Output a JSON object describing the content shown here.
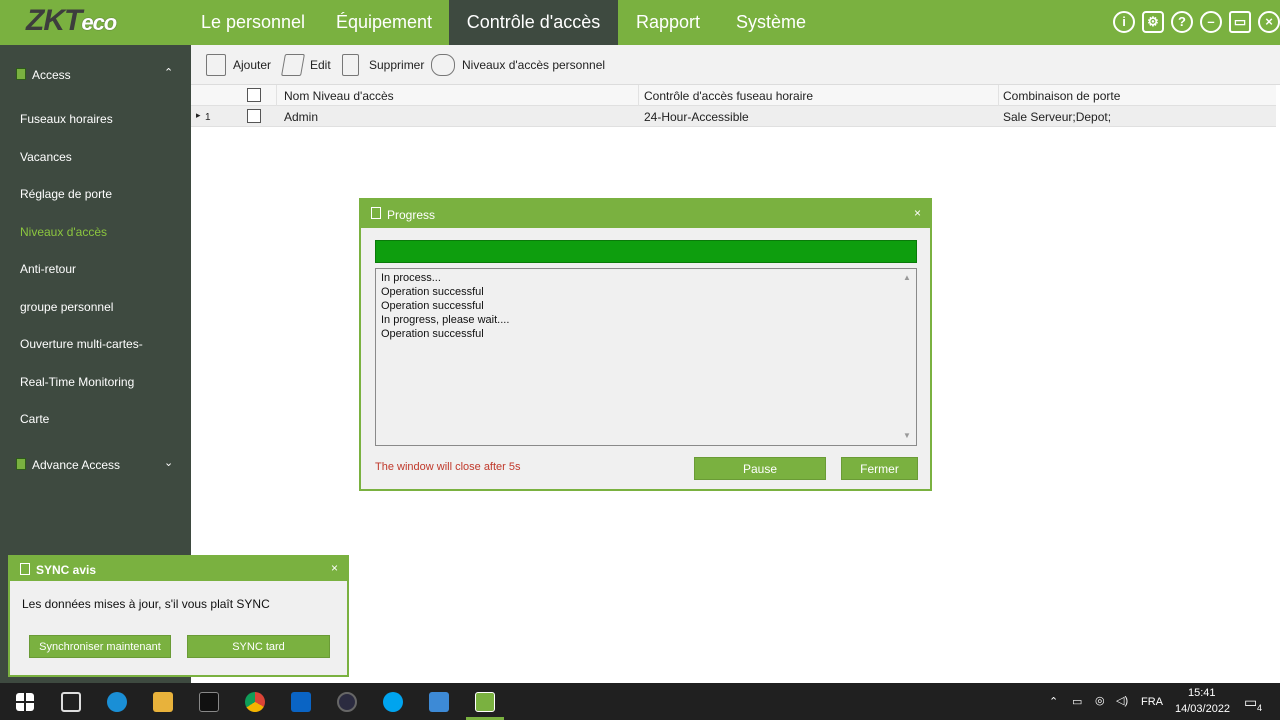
{
  "brand": {
    "logo_main": "ZKT",
    "logo_suffix": "eco"
  },
  "menu": {
    "items": [
      "Le personnel",
      "Équipement",
      "Contrôle d'accès",
      "Rapport",
      "Système"
    ],
    "active": "Contrôle d'accès"
  },
  "window_icons": [
    "info-icon",
    "gear-icon",
    "help-icon",
    "minimize-icon",
    "restore-icon",
    "close-icon"
  ],
  "sidebar": {
    "group_access": "Access",
    "items": [
      "Fuseaux horaires",
      "Vacances",
      "Réglage de porte",
      "Niveaux d'accès",
      "Anti-retour",
      "groupe personnel",
      "Ouverture multi-cartes-",
      "Real-Time Monitoring",
      "Carte"
    ],
    "active_item": "Niveaux d'accès",
    "group_advance": "Advance Access"
  },
  "toolbar": {
    "add": "Ajouter",
    "edit": "Edit",
    "delete": "Supprimer",
    "personal_levels": "Niveaux d'accès personnel"
  },
  "grid": {
    "columns": [
      "Nom Niveau d'accès",
      "Contrôle d'accès fuseau horaire",
      "Combinaison de porte"
    ],
    "rows": [
      {
        "index": "1",
        "name": "Admin",
        "timezone": "24-Hour-Accessible",
        "doors": "Sale Serveur;Depot;"
      }
    ]
  },
  "progress_dialog": {
    "title": "Progress",
    "progress_fraction": 1.0,
    "log": [
      "In process...",
      "Operation successful",
      "Operation successful",
      "In progress, please wait....",
      "Operation successful"
    ],
    "close_note": "The window will close after 5s",
    "pause_label": "Pause",
    "close_label": "Fermer"
  },
  "sync_notice": {
    "title": "SYNC avis",
    "message": "Les données mises à jour, s'il vous plaît SYNC",
    "sync_now": "Synchroniser maintenant",
    "sync_later": "SYNC tard"
  },
  "taskbar": {
    "language": "FRA",
    "time": "15:41",
    "date": "14/03/2022",
    "notification_count": "4"
  },
  "colors": {
    "brand_green": "#7ab140",
    "sidebar_bg": "#3e4a40",
    "progress_fill": "#0e9e0e",
    "warning_text": "#c0392b"
  }
}
